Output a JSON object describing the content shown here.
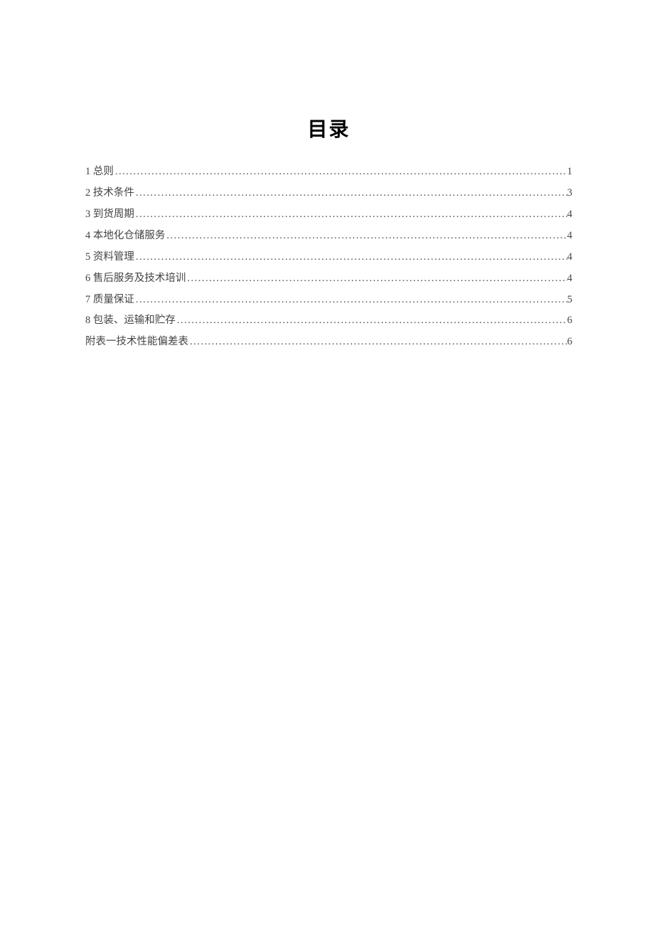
{
  "title": "目录",
  "entries": [
    {
      "label": "1 总则",
      "page": "1"
    },
    {
      "label": "2 技术条件",
      "page": "3"
    },
    {
      "label": "3 到货周期",
      "page": "4"
    },
    {
      "label": "4 本地化仓储服务",
      "page": "4"
    },
    {
      "label": "5 资料管理",
      "page": "4"
    },
    {
      "label": "6 售后服务及技术培训",
      "page": "4"
    },
    {
      "label": "7 质量保证",
      "page": "5"
    },
    {
      "label": "8 包装、运输和贮存",
      "page": "6"
    },
    {
      "label": "附表一技术性能偏差表",
      "page": "6"
    }
  ]
}
